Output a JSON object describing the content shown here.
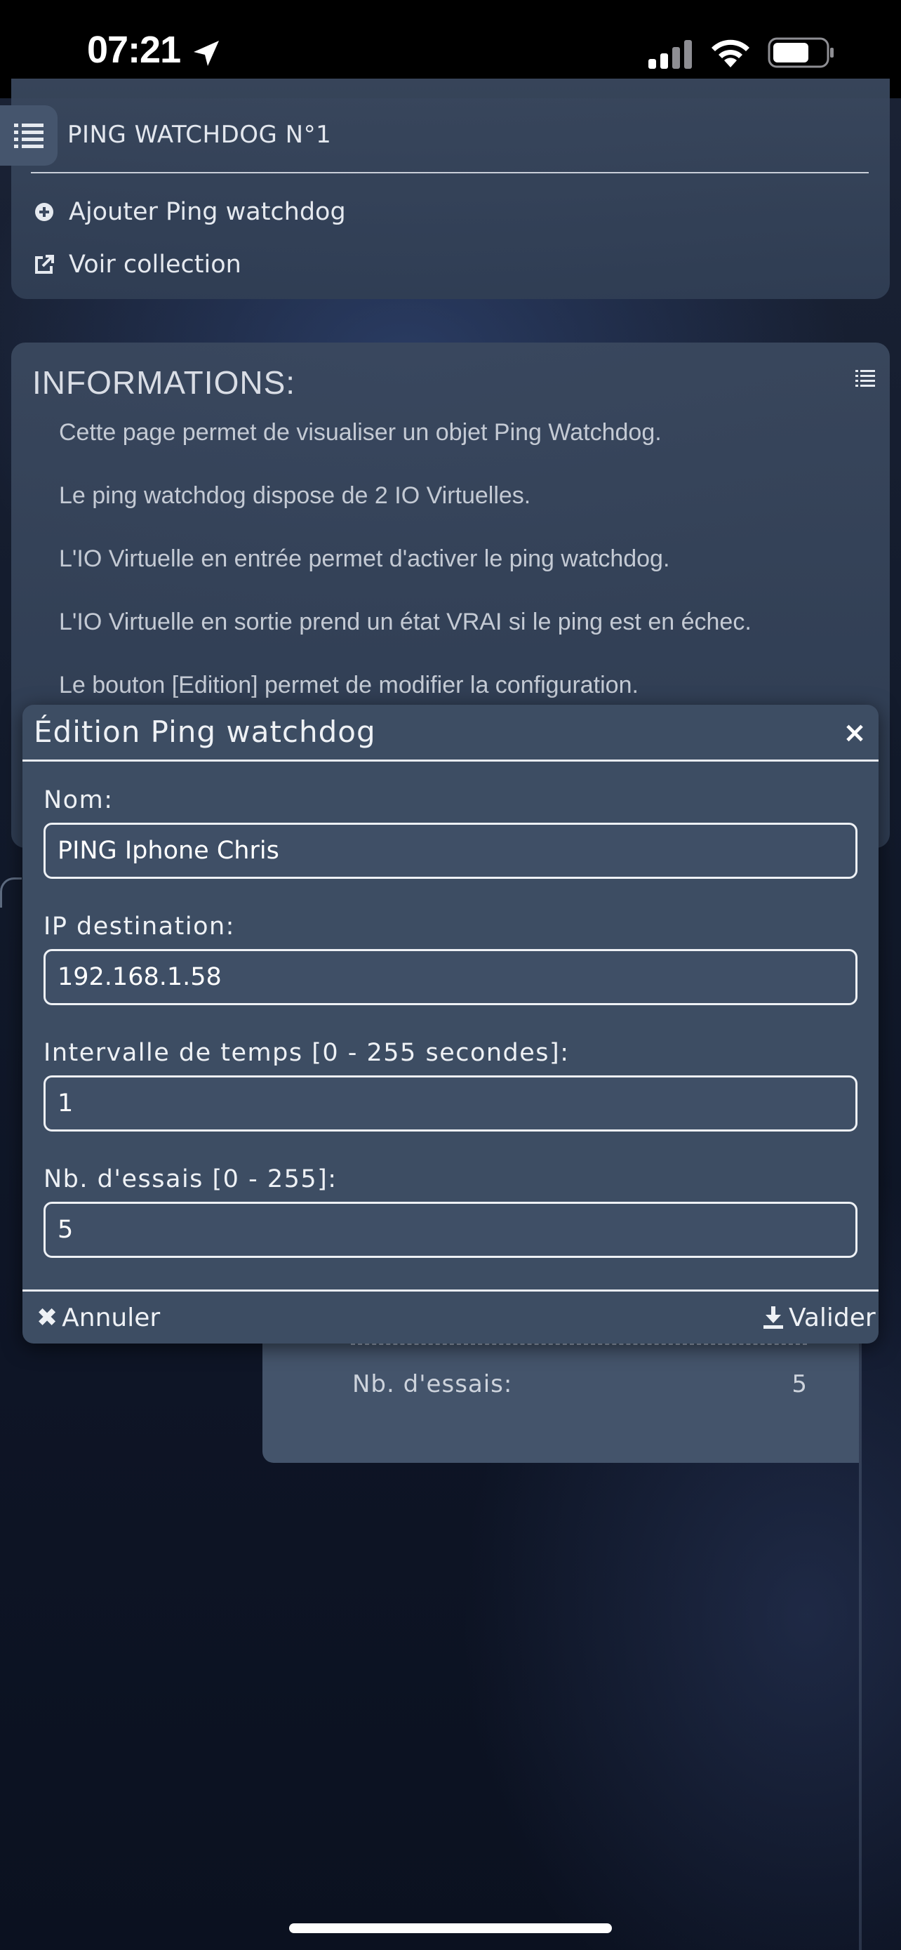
{
  "status_bar": {
    "time": "07:21"
  },
  "header": {
    "title": "PING WATCHDOG N°1",
    "actions": [
      {
        "label": "Ajouter Ping watchdog",
        "icon": "plus-circle-icon"
      },
      {
        "label": "Voir collection",
        "icon": "external-link-icon"
      }
    ]
  },
  "info": {
    "title": "INFORMATIONS:",
    "lines": [
      "Cette page permet de visualiser un objet Ping Watchdog.",
      "Le ping watchdog dispose de 2 IO Virtuelles.",
      "L'IO Virtuelle en entrée permet d'activer le ping watchdog.",
      "L'IO Virtuelle en sortie prend un état VRAI si le ping est en échec.",
      "Le bouton [Edition] permet de modifier la configuration."
    ]
  },
  "details": {
    "tries_label": "Nb. d'essais:",
    "tries_value": "5"
  },
  "modal": {
    "title": "Édition Ping watchdog",
    "close_glyph": "×",
    "fields": [
      {
        "label": "Nom:",
        "value": "PING Iphone Chris"
      },
      {
        "label": "IP destination:",
        "value": "192.168.1.58"
      },
      {
        "label": "Intervalle de temps [0 - 255 secondes]:",
        "value": "1"
      },
      {
        "label": "Nb. d'essais [0 - 255]:",
        "value": "5"
      }
    ],
    "cancel_label": "Annuler",
    "cancel_glyph": "✖",
    "submit_label": "Valider"
  },
  "colors": {
    "card_bg": "#3a485e",
    "modal_bg": "#3d4d63",
    "status_bar_bg": "#000000"
  }
}
